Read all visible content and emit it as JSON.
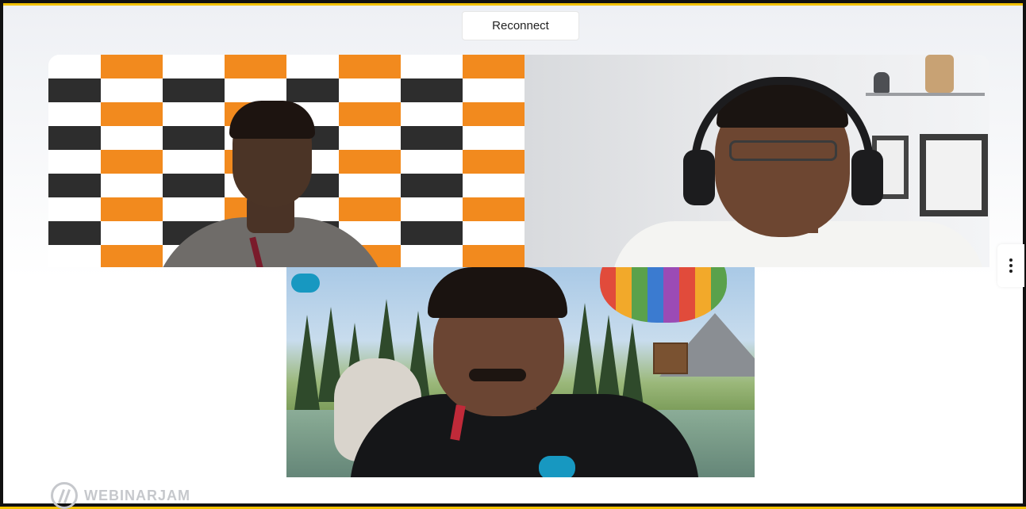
{
  "toolbar": {
    "reconnect_label": "Reconnect"
  },
  "brand": {
    "name": "WEBINARJAM"
  },
  "icons": {
    "more_menu": "vertical-ellipsis-icon",
    "brand_logo": "webinarjam-logo-icon",
    "cloud_logo": "salesforce-cloud-icon"
  },
  "colors": {
    "frame_border": "#111111",
    "outer_background": "#f2c200",
    "checker_orange": "#f28a1e",
    "checker_dark": "#2d2d2d",
    "brand_gray": "#c6c8cc"
  }
}
